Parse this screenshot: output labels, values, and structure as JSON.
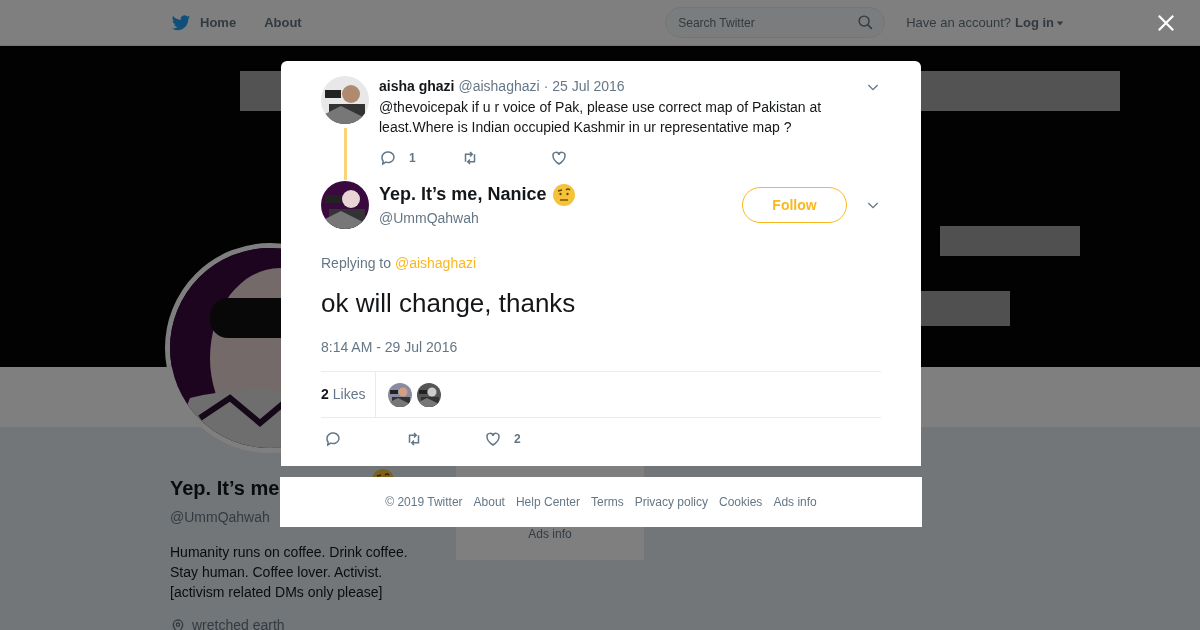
{
  "header": {
    "nav": [
      "Home",
      "About"
    ],
    "search": {
      "placeholder": "Search Twitter"
    },
    "account_prompt": "Have an account?",
    "login": "Log in"
  },
  "profile": {
    "name": "Yep. It’s me",
    "handle": "@UmmQahwah",
    "bio": [
      "Humanity runs on coffee. Drink coffee.",
      "Stay human. Coffee lover. Activist.",
      "[activism related DMs only please]"
    ],
    "location": "wretched earth"
  },
  "sidebar_card": {
    "link": "Ads info"
  },
  "modal": {
    "parent_tweet": {
      "name": "aisha ghazi",
      "handle": "@aishaghazi",
      "date": "· 25 Jul 2016",
      "text": "@thevoicepak if u r voice of Pak, please use correct map of Pakistan at least.Where is Indian occupied Kashmir in ur representative map ?",
      "reply_count": "1"
    },
    "tweet": {
      "name": "Yep. It’s me, Nanice",
      "handle": "@UmmQahwah",
      "follow": "Follow",
      "replying_label": "Replying to",
      "replying_to": "@aishaghazi",
      "text": "ok will change, thanks",
      "timestamp": "8:14 AM - 29 Jul 2016"
    },
    "stats": {
      "likes_count": "2",
      "likes_label": "Likes"
    },
    "actions": {
      "like_count": "2"
    }
  },
  "footer": {
    "links": [
      "© 2019 Twitter",
      "About",
      "Help Center",
      "Terms",
      "Privacy policy",
      "Cookies",
      "Ads info"
    ]
  }
}
